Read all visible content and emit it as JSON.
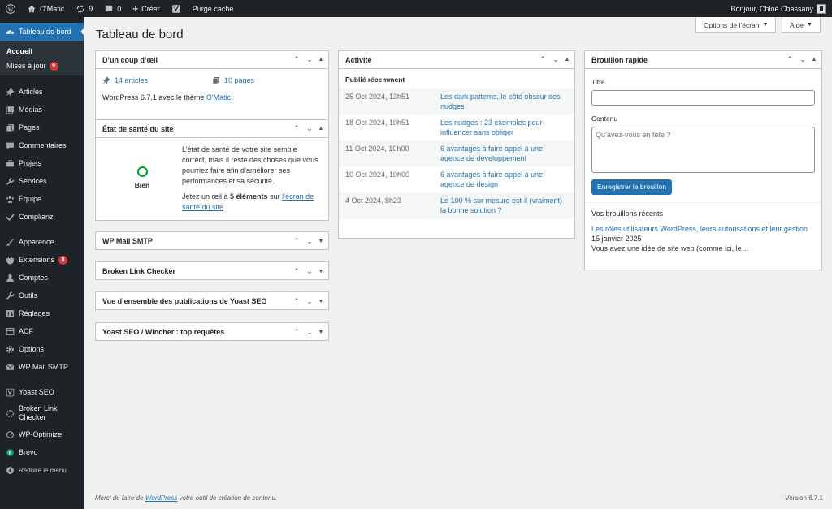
{
  "adminbar": {
    "site_name": "O'Matic",
    "updates_count": "9",
    "comments_count": "0",
    "create_label": "Créer",
    "purge_label": "Purge cache",
    "greeting": "Bonjour, Chloé Chassany"
  },
  "sidebar": {
    "dashboard_label": "Tableau de bord",
    "home_label": "Accueil",
    "updates_label": "Mises à jour",
    "updates_badge": "9",
    "items": [
      {
        "label": "Articles"
      },
      {
        "label": "Médias"
      },
      {
        "label": "Pages"
      },
      {
        "label": "Commentaires"
      },
      {
        "label": "Projets"
      },
      {
        "label": "Services"
      },
      {
        "label": "Équipe"
      },
      {
        "label": "Complianz"
      },
      {
        "label": "Apparence"
      },
      {
        "label": "Extensions",
        "badge": "8"
      },
      {
        "label": "Comptes"
      },
      {
        "label": "Outils"
      },
      {
        "label": "Réglages"
      },
      {
        "label": "ACF"
      },
      {
        "label": "Options"
      },
      {
        "label": "WP Mail SMTP"
      },
      {
        "label": "Yoast SEO"
      },
      {
        "label": "Broken Link Checker"
      },
      {
        "label": "WP-Optimize"
      },
      {
        "label": "Brevo"
      }
    ],
    "collapse_label": "Réduire le menu"
  },
  "header": {
    "screen_options": "Options de l’écran",
    "help": "Aide",
    "title": "Tableau de bord"
  },
  "glance": {
    "title": "D’un coup d’œil",
    "articles": "14 articles",
    "pages": "10 pages",
    "version_prefix": "WordPress 6.7.1 avec le thème ",
    "theme": "O'Matic",
    "version_suffix": "."
  },
  "health": {
    "title": "État de santé du site",
    "status": "Bien",
    "text": "L’état de santé de votre site semble correct, mais il reste des choses que vous pourriez faire afin d’améliorer ses performances et sa sécurité.",
    "link_prefix": "Jetez un œil à ",
    "link_count": "5 éléments",
    "link_mid": " sur ",
    "link_text": "l’écran de santé du site",
    "link_suffix": "."
  },
  "closed_boxes": [
    {
      "title": "WP Mail SMTP"
    },
    {
      "title": "Broken Link Checker"
    },
    {
      "title": "Vue d’ensemble des publications de Yoast SEO"
    },
    {
      "title": "Yoast SEO / Wincher : top requêtes"
    }
  ],
  "activity": {
    "title": "Activité",
    "subtitle": "Publié récemment",
    "rows": [
      {
        "date": "25 Oct 2024, 13h51",
        "title": "Les dark patterns, le côté obscur des nudges"
      },
      {
        "date": "18 Oct 2024, 10h51",
        "title": "Les nudges : 23 exemples pour influencer sans obliger"
      },
      {
        "date": "11 Oct 2024, 10h00",
        "title": "6 avantages à faire appel à une agence de développement"
      },
      {
        "date": "10 Oct 2024, 10h00",
        "title": "6 avantages à faire appel à une agence de design"
      },
      {
        "date": "4 Oct 2024, 8h23",
        "title": "Le 100 % sur mesure est-il (vraiment) la bonne solution ?"
      }
    ]
  },
  "quickdraft": {
    "title": "Brouillon rapide",
    "title_label": "Titre",
    "title_value": "",
    "content_label": "Contenu",
    "content_placeholder": "Qu’avez-vous en tête ?",
    "save_label": "Enregistrer le brouillon",
    "recent_heading": "Vos brouillons récents",
    "draft_title": "Les rôles utilisateurs WordPress, leurs autorisations et leur gestion",
    "draft_date": " 15 janvier 2025",
    "draft_excerpt": "Vous avez une idée de site web (comme ici, le…"
  },
  "footer": {
    "prefix": "Merci de faire de ",
    "link": "WordPress",
    "suffix": " votre outil de création de contenu.",
    "version": "Version 6.7.1"
  },
  "colors": {
    "adminbar": "#1d2327",
    "accent": "#2271b1",
    "badge": "#d63638",
    "health_good": "#00a32a"
  }
}
